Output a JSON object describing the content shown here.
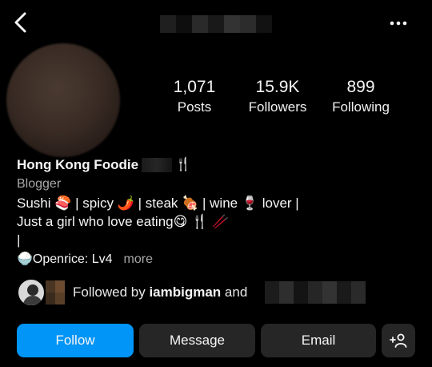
{
  "header": {
    "back_icon": "chevron-left-icon",
    "more_icon": "ellipsis-icon",
    "username_redacted": true
  },
  "stats": [
    {
      "value": "1,071",
      "label": "Posts"
    },
    {
      "value": "15.9K",
      "label": "Followers"
    },
    {
      "value": "899",
      "label": "Following"
    }
  ],
  "profile": {
    "name": "Hong Kong Foodie",
    "name_emoji": "🍴",
    "category": "Blogger",
    "bio_lines": [
      "Sushi 🍣 | spicy 🌶️ | steak 🍖 | wine 🍷 lover |",
      "Just a girl who love eating😋 🍴 🥢",
      "|"
    ],
    "openrice_line": "🍚Openrice: Lv4",
    "more_label": "more"
  },
  "followed_by": {
    "prefix": "Followed by ",
    "user": "iambigman",
    "suffix": " and"
  },
  "actions": {
    "follow_label": "Follow",
    "message_label": "Message",
    "email_label": "Email",
    "add_user_icon": "add-user-icon"
  },
  "colors": {
    "background": "#000000",
    "follow_button": "#0095f6",
    "secondary_button": "#262626",
    "muted_text": "#a8a8a8"
  }
}
